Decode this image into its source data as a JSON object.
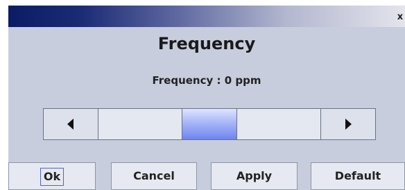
{
  "dialog": {
    "close_label": "x",
    "heading": "Frequency",
    "frequency_label": "Frequency : 0 ppm",
    "slider": {
      "position_fraction": 0.5
    },
    "buttons": {
      "ok": "Ok",
      "cancel": "Cancel",
      "apply": "Apply",
      "default": "Default"
    }
  },
  "colors": {
    "titlebar_start": "#0c1c64",
    "titlebar_end": "#e4e4ec",
    "dialog_background": "#c7cddd",
    "thumb_accent": "#6f84f0"
  },
  "icons": {
    "close": "close-icon",
    "left": "arrow-left-icon",
    "right": "arrow-right-icon"
  }
}
